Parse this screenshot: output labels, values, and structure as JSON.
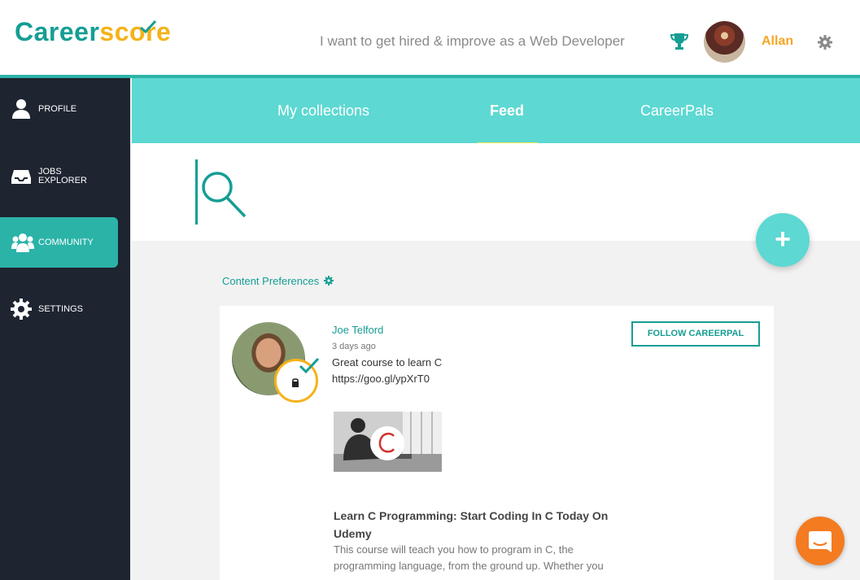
{
  "header": {
    "logo_part1": "Career",
    "logo_part2": "score",
    "tagline": "I want to get hired & improve as a Web Developer",
    "username": "Allan",
    "icons": [
      "trophy-icon",
      "avatar",
      "gear-icon"
    ]
  },
  "sidebar": {
    "items": [
      {
        "label": "PROFILE",
        "icon": "user-icon",
        "active": false
      },
      {
        "label_line1": "JOBS",
        "label_line2": "EXPLORER",
        "icon": "inbox-icon",
        "active": false
      },
      {
        "label": "COMMUNITY",
        "icon": "users-icon",
        "active": true
      },
      {
        "label": "SETTINGS",
        "icon": "gear-icon",
        "active": false
      }
    ]
  },
  "tabs": [
    {
      "label": "My collections",
      "active": false
    },
    {
      "label": "Feed",
      "active": true
    },
    {
      "label": "CareerPals",
      "active": false
    }
  ],
  "main": {
    "add_button": "+",
    "content_preferences": "Content Preferences"
  },
  "post": {
    "author": "Joe Telford",
    "time": "3 days ago",
    "text": "Great course to learn C",
    "link": "https://goo.gl/ypXrT0",
    "follow_label": "FOLLOW CAREERPAL",
    "course_title": "Learn C Programming: Start Coding In C Today On Udemy",
    "course_desc": "This course will teach you how to program in C, the programming language, from the ground up. Whether you"
  },
  "colors": {
    "accent": "#2bb3a8",
    "tab_band": "#5dd8d2",
    "sidebar": "#1e2430",
    "brand_yellow": "#f5b21a",
    "chat": "#f47b20"
  }
}
